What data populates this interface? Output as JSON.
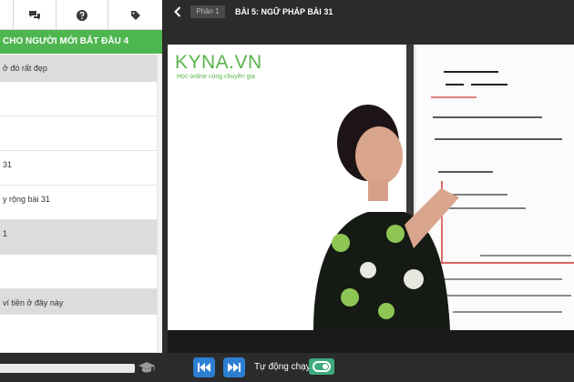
{
  "sidebar": {
    "tabs": [
      {
        "icon": "list-icon"
      },
      {
        "icon": "chat-bubbles-icon"
      },
      {
        "icon": "question-circle-icon"
      },
      {
        "icon": "tag-icon"
      }
    ],
    "course_title": "CHO NGƯỜI MỚI BẮT ĐẦU 4",
    "lessons": [
      {
        "text": "ở đó rất đẹp"
      },
      {
        "text": ""
      },
      {
        "text": ""
      },
      {
        "text": "31"
      },
      {
        "text": "y rộng bài 31"
      },
      {
        "text": "1"
      },
      {
        "text": ""
      },
      {
        "text": "ví tiền ở đây này"
      },
      {
        "text": ""
      }
    ]
  },
  "player": {
    "part_label": "Phần 1",
    "lesson_title": "BÀI 5: NGỮ PHÁP BÀI 31",
    "logo": "KYNA.VN",
    "logo_tagline": "Học online cùng chuyên gia"
  },
  "controls": {
    "autoplay_label": "Tự động chạy:",
    "autoplay_on": true,
    "progress": 0,
    "icons": {
      "back": "chevron-left-icon",
      "prev": "skip-previous-icon",
      "next": "skip-next-icon",
      "cap": "graduation-cap-icon"
    }
  },
  "colors": {
    "accent_green": "#4eb64f",
    "button_blue": "#2d7fd3",
    "toggle_green": "#3daa7e"
  }
}
